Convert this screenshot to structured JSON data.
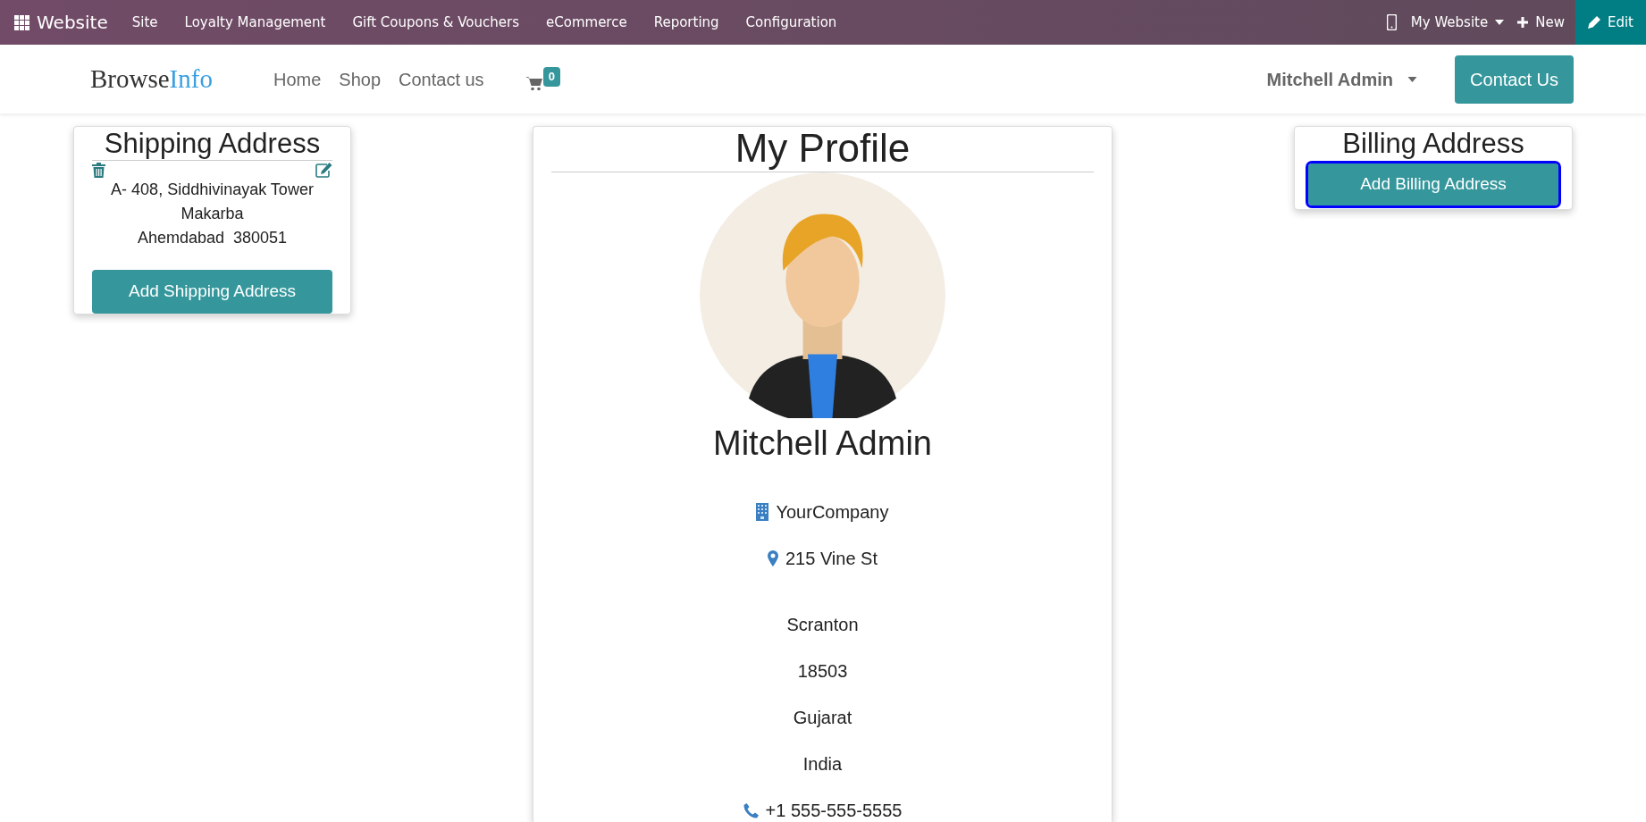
{
  "topbar": {
    "app": "Website",
    "menu": [
      "Site",
      "Loyalty Management",
      "Gift Coupons & Vouchers",
      "eCommerce",
      "Reporting",
      "Configuration"
    ],
    "website": "My Website",
    "new": "New",
    "edit": "Edit"
  },
  "header": {
    "logo": [
      "Browse",
      "Info"
    ],
    "nav": [
      "Home",
      "Shop",
      "Contact us"
    ],
    "cart_count": "0",
    "user": "Mitchell Admin",
    "contact_button": "Contact Us"
  },
  "shipping": {
    "title": "Shipping Address",
    "address_lines": [
      "A- 408, Siddhivinayak Tower",
      "Makarba",
      "Ahemdabad  380051"
    ],
    "button": "Add Shipping Address"
  },
  "profile": {
    "title": "My Profile",
    "name": "Mitchell Admin",
    "details": [
      {
        "kind": "company",
        "text": "YourCompany"
      },
      {
        "kind": "address",
        "text": "215 Vine St"
      },
      {
        "kind": "plain",
        "text": "Scranton"
      },
      {
        "kind": "plain",
        "text": "18503"
      },
      {
        "kind": "plain",
        "text": "Gujarat"
      },
      {
        "kind": "plain",
        "text": "India"
      },
      {
        "kind": "phone",
        "text": "+1 555-555-5555"
      }
    ]
  },
  "billing": {
    "title": "Billing Address",
    "button": "Add Billing Address",
    "focused": true
  }
}
